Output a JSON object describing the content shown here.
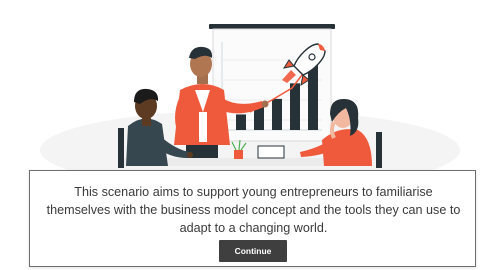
{
  "dialog": {
    "message": "This scenario aims to support young entrepreneurs to familiarise themselves with the business model concept and the tools they can use to adapt to a changing world.",
    "continue_label": "Continue"
  },
  "colors": {
    "accent_orange": "#f05a3c",
    "chart_bar": "#263238",
    "button_bg": "#3f3f3f"
  },
  "chart_data": {
    "type": "bar",
    "categories": [
      "",
      "",
      "",
      "",
      ""
    ],
    "values": [
      2,
      3,
      4,
      6,
      9
    ],
    "title": "",
    "xlabel": "",
    "ylabel": ""
  }
}
